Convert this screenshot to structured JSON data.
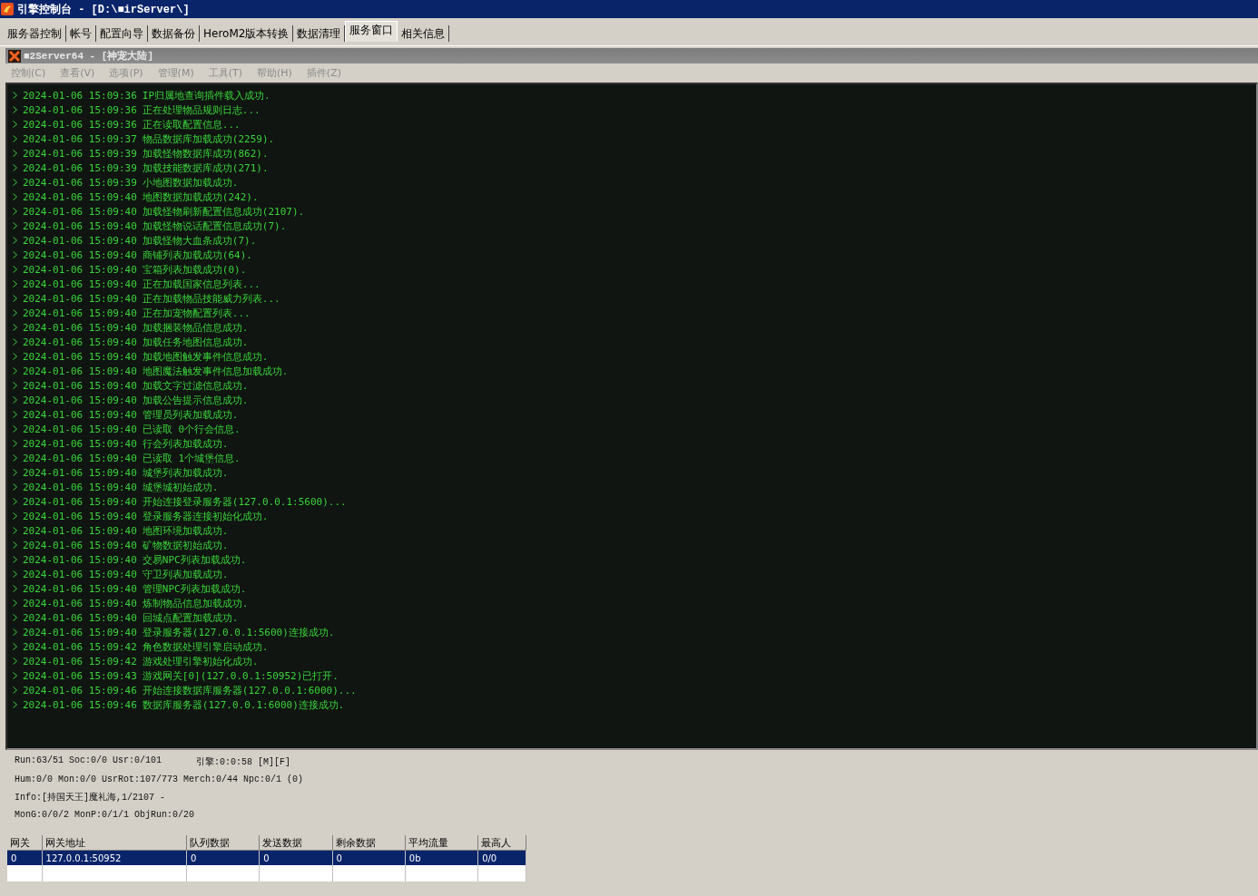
{
  "window": {
    "title": "引擎控制台 - [D:\\■irServer\\]"
  },
  "tabs": [
    {
      "label": "服务器控制",
      "selected": false
    },
    {
      "label": "帐号",
      "selected": false
    },
    {
      "label": "配置向导",
      "selected": false
    },
    {
      "label": "数据备份",
      "selected": false
    },
    {
      "label": "HeroM2版本转换",
      "selected": false
    },
    {
      "label": "数据清理",
      "selected": false
    },
    {
      "label": "服务窗口",
      "selected": true
    },
    {
      "label": "相关信息",
      "selected": false
    }
  ],
  "server_window": {
    "title": "■2Server64 - [神宠大陆]",
    "menu": [
      "控制(C)",
      "查看(V)",
      "选项(P)",
      "管理(M)",
      "工具(T)",
      "帮助(H)",
      "插件(Z)"
    ]
  },
  "log": [
    {
      "time": "2024-01-06 15:09:36",
      "message": "IP归属地查询插件载入成功."
    },
    {
      "time": "2024-01-06 15:09:36",
      "message": "正在处理物品规则日志..."
    },
    {
      "time": "2024-01-06 15:09:36",
      "message": "正在读取配置信息..."
    },
    {
      "time": "2024-01-06 15:09:37",
      "message": "物品数据库加载成功(2259)."
    },
    {
      "time": "2024-01-06 15:09:39",
      "message": "加载怪物数据库成功(862)."
    },
    {
      "time": "2024-01-06 15:09:39",
      "message": "加载技能数据库成功(271)."
    },
    {
      "time": "2024-01-06 15:09:39",
      "message": "小地图数据加载成功."
    },
    {
      "time": "2024-01-06 15:09:40",
      "message": "地图数据加载成功(242)."
    },
    {
      "time": "2024-01-06 15:09:40",
      "message": "加载怪物刷新配置信息成功(2107)."
    },
    {
      "time": "2024-01-06 15:09:40",
      "message": "加载怪物说话配置信息成功(7)."
    },
    {
      "time": "2024-01-06 15:09:40",
      "message": "加载怪物大血条成功(7)."
    },
    {
      "time": "2024-01-06 15:09:40",
      "message": "商铺列表加载成功(64)."
    },
    {
      "time": "2024-01-06 15:09:40",
      "message": "宝箱列表加载成功(0)."
    },
    {
      "time": "2024-01-06 15:09:40",
      "message": "正在加载国家信息列表..."
    },
    {
      "time": "2024-01-06 15:09:40",
      "message": "正在加载物品技能威力列表..."
    },
    {
      "time": "2024-01-06 15:09:40",
      "message": "正在加宠物配置列表..."
    },
    {
      "time": "2024-01-06 15:09:40",
      "message": "加载捆装物品信息成功."
    },
    {
      "time": "2024-01-06 15:09:40",
      "message": "加载任务地图信息成功."
    },
    {
      "time": "2024-01-06 15:09:40",
      "message": "加载地图触发事件信息成功."
    },
    {
      "time": "2024-01-06 15:09:40",
      "message": "地图魔法触发事件信息加载成功."
    },
    {
      "time": "2024-01-06 15:09:40",
      "message": "加载文字过滤信息成功."
    },
    {
      "time": "2024-01-06 15:09:40",
      "message": "加载公告提示信息成功."
    },
    {
      "time": "2024-01-06 15:09:40",
      "message": "管理员列表加载成功."
    },
    {
      "time": "2024-01-06 15:09:40",
      "message": "已读取 0个行会信息."
    },
    {
      "time": "2024-01-06 15:09:40",
      "message": "行会列表加载成功."
    },
    {
      "time": "2024-01-06 15:09:40",
      "message": "已读取 1个城堡信息."
    },
    {
      "time": "2024-01-06 15:09:40",
      "message": "城堡列表加载成功."
    },
    {
      "time": "2024-01-06 15:09:40",
      "message": "城堡城初始成功."
    },
    {
      "time": "2024-01-06 15:09:40",
      "message": "开始连接登录服务器(127.0.0.1:5600)..."
    },
    {
      "time": "2024-01-06 15:09:40",
      "message": "登录服务器连接初始化成功."
    },
    {
      "time": "2024-01-06 15:09:40",
      "message": "地图环境加载成功."
    },
    {
      "time": "2024-01-06 15:09:40",
      "message": "矿物数据初始成功."
    },
    {
      "time": "2024-01-06 15:09:40",
      "message": "交易NPC列表加载成功."
    },
    {
      "time": "2024-01-06 15:09:40",
      "message": "守卫列表加载成功."
    },
    {
      "time": "2024-01-06 15:09:40",
      "message": "管理NPC列表加载成功."
    },
    {
      "time": "2024-01-06 15:09:40",
      "message": "炼制物品信息加载成功."
    },
    {
      "time": "2024-01-06 15:09:40",
      "message": "回城点配置加载成功."
    },
    {
      "time": "2024-01-06 15:09:40",
      "message": "登录服务器(127.0.0.1:5600)连接成功."
    },
    {
      "time": "2024-01-06 15:09:42",
      "message": "角色数据处理引擎启动成功."
    },
    {
      "time": "2024-01-06 15:09:42",
      "message": "游戏处理引擎初始化成功."
    },
    {
      "time": "2024-01-06 15:09:43",
      "message": "游戏网关[0](127.0.0.1:50952)已打开."
    },
    {
      "time": "2024-01-06 15:09:46",
      "message": "开始连接数据库服务器(127.0.0.1:6000)..."
    },
    {
      "time": "2024-01-06 15:09:46",
      "message": "数据库服务器(127.0.0.1:6000)连接成功."
    }
  ],
  "status": {
    "run": "Run:63/51 Soc:0/0 Usr:0/101",
    "engine": "引擎:0:0:58 [M][F]",
    "counts": "Hum:0/0 Mon:0/0 UsrRot:107/773 Merch:0/44 Npc:0/1 (0)",
    "info": "Info:[持国天王]魔礼海,1/2107 -",
    "mon": "MonG:0/0/2 MonP:0/1/1 ObjRun:0/20"
  },
  "gateway_table": {
    "columns": [
      "网关",
      "网关地址",
      "队列数据",
      "发送数据",
      "剩余数据",
      "平均流量",
      "最高人"
    ],
    "rows": [
      {
        "selected": true,
        "cells": [
          "0",
          "127.0.0.1:50952",
          "0",
          "0",
          "0",
          "0b",
          "0/0"
        ]
      }
    ]
  }
}
